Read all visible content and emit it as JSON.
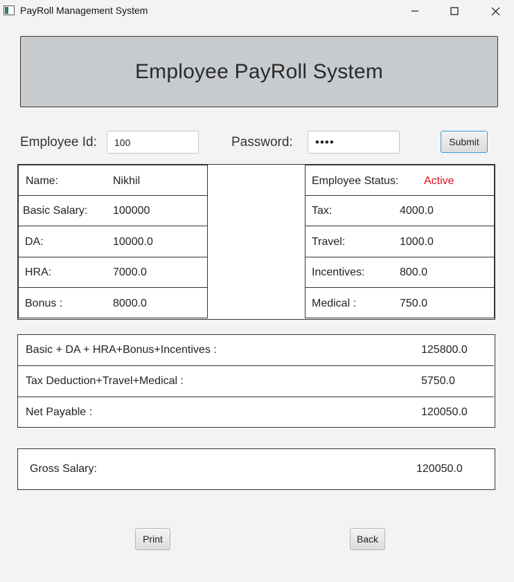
{
  "window": {
    "title": "PayRoll Management System"
  },
  "header": {
    "title": "Employee PayRoll System"
  },
  "login": {
    "employee_id_label": "Employee Id:",
    "employee_id_value": "100",
    "password_label": "Password:",
    "password_value": "••••",
    "submit_label": "Submit"
  },
  "details": {
    "left": [
      {
        "label": "Name:",
        "value": "Nikhil"
      },
      {
        "label": "Basic Salary:",
        "value": "100000"
      },
      {
        "label": "DA:",
        "value": "10000.0"
      },
      {
        "label": "HRA:",
        "value": "7000.0"
      },
      {
        "label": "Bonus :",
        "value": "8000.0"
      }
    ],
    "right": [
      {
        "label": "Employee Status:",
        "value": "Active"
      },
      {
        "label": "Tax:",
        "value": "4000.0"
      },
      {
        "label": "Travel:",
        "value": "1000.0"
      },
      {
        "label": "Incentives:",
        "value": "800.0"
      },
      {
        "label": "Medical :",
        "value": "750.0"
      }
    ],
    "status_color": "#e0101a"
  },
  "summary": [
    {
      "label": "Basic + DA + HRA+Bonus+Incentives :",
      "value": "125800.0"
    },
    {
      "label": "Tax Deduction+Travel+Medical :",
      "value": "5750.0"
    },
    {
      "label": "Net Payable :",
      "value": "120050.0"
    }
  ],
  "gross": {
    "label": "Gross Salary:",
    "value": "120050.0"
  },
  "actions": {
    "print_label": "Print",
    "back_label": "Back"
  }
}
